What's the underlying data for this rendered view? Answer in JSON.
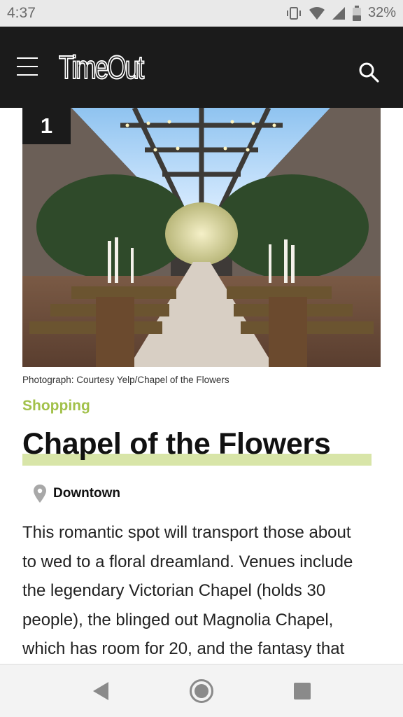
{
  "status_bar": {
    "time": "4:37",
    "battery": "32%",
    "icons": [
      "vibrate-icon",
      "wifi-icon",
      "signal-icon",
      "battery-icon"
    ]
  },
  "app_bar": {
    "logo": "TimeOut",
    "menu_icon": "hamburger-menu-icon",
    "search_icon": "search-icon",
    "background": "#1b1b1b"
  },
  "article": {
    "rank": "1",
    "image_caption": "Photograph: Courtesy Yelp/Chapel of the Flowers",
    "category": "Shopping",
    "title": "Chapel of the Flowers",
    "location": "Downtown",
    "body_lines": [
      "This romantic spot will transport those about",
      "to wed to a floral dreamland. Venues include",
      "the legendary Victorian Chapel (holds 30",
      "people), the blinged out Magnolia Chapel,",
      "which has room for 20, and the fantasy that"
    ],
    "accent_color": "#a2c14a",
    "highlight_color": "#d8e5a8"
  },
  "nav_bar": {
    "icons": [
      "back-icon",
      "home-icon",
      "recents-icon"
    ]
  }
}
